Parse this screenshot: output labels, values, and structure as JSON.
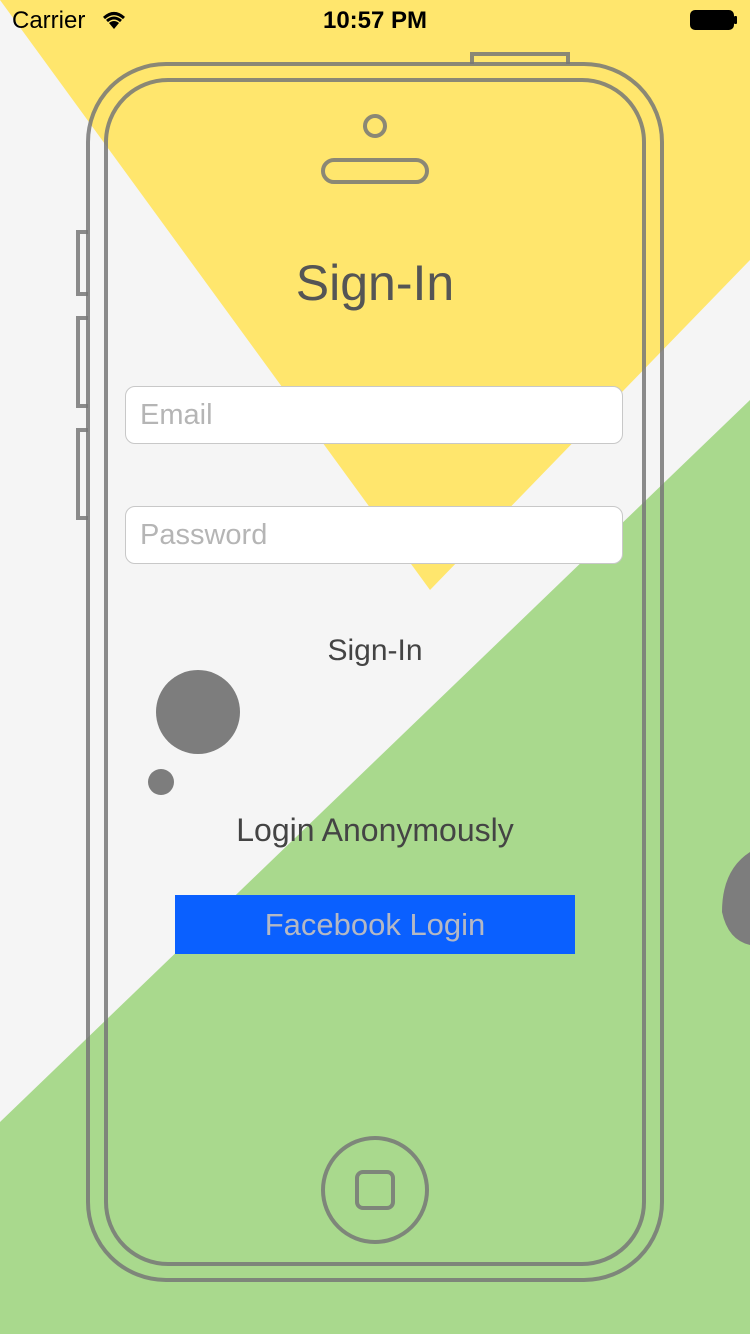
{
  "status_bar": {
    "carrier": "Carrier",
    "time": "10:57 PM"
  },
  "page": {
    "title": "Sign-In"
  },
  "form": {
    "email_placeholder": "Email",
    "email_value": "",
    "password_placeholder": "Password",
    "password_value": "",
    "signin_label": "Sign-In"
  },
  "anonymous_label": "Login Anonymously",
  "facebook_label": "Facebook Login",
  "colors": {
    "yellow": "#ffe66d",
    "pink": "#ff6b87",
    "green": "#a9d98d",
    "facebook_blue": "#0a60ff",
    "outline_gray": "#777777"
  }
}
